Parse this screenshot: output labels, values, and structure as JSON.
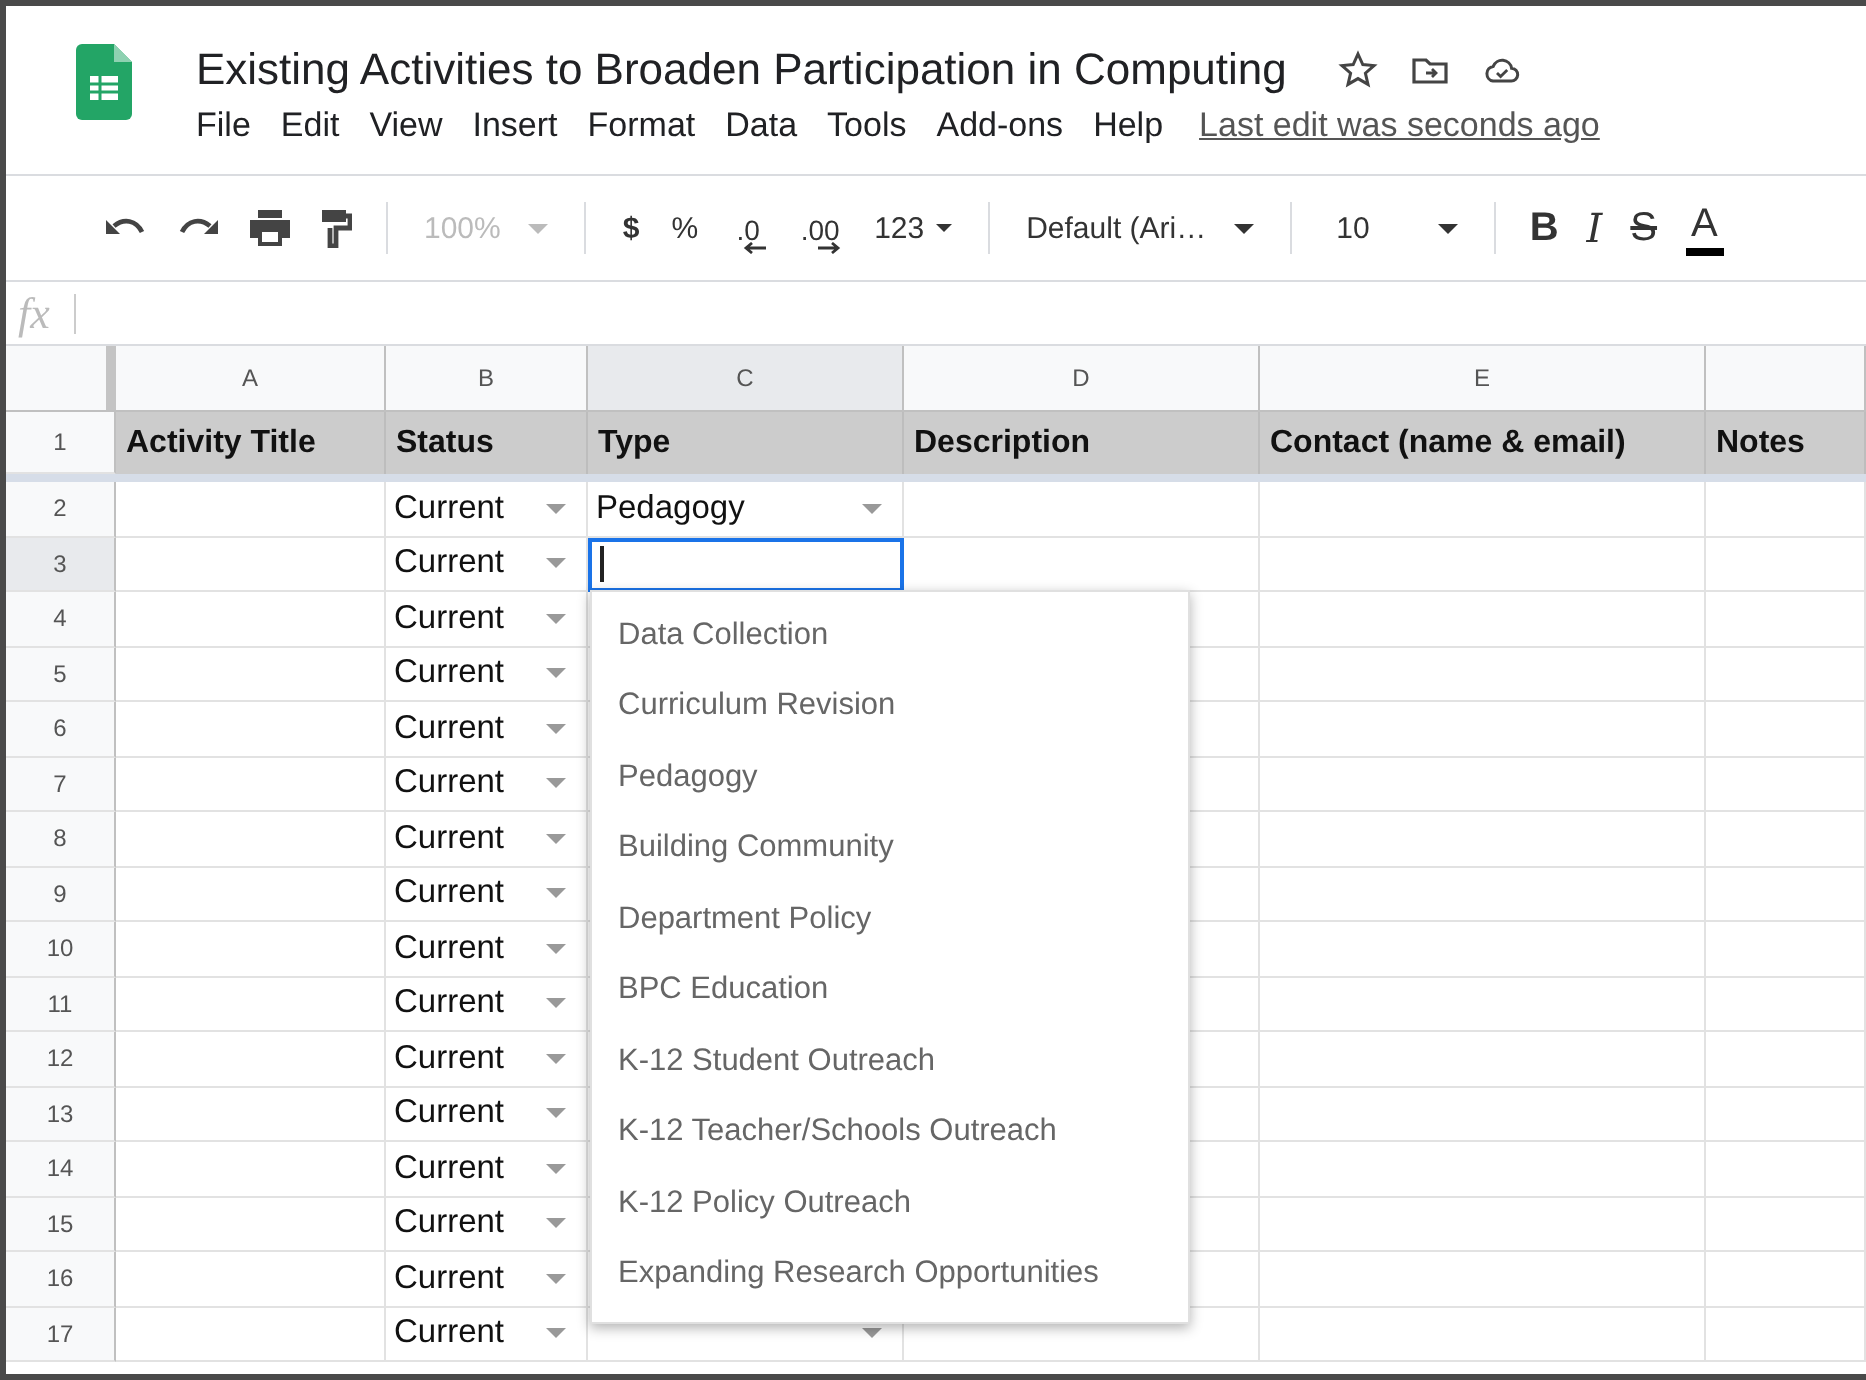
{
  "document": {
    "title": "Existing Activities to Broaden Participation in Computing"
  },
  "menu": [
    "File",
    "Edit",
    "View",
    "Insert",
    "Format",
    "Data",
    "Tools",
    "Add-ons",
    "Help"
  ],
  "last_edit": "Last edit was seconds ago",
  "toolbar": {
    "zoom": {
      "value": "100%",
      "disabled": true
    },
    "currency": "$",
    "percent": "%",
    "decrease_decimals": ".0",
    "increase_decimals": ".00",
    "more_formats": "123",
    "font": "Default (Ari…",
    "font_size": "10",
    "bold": "B",
    "italic": "I",
    "strikethrough": "S",
    "text_color": "A"
  },
  "formula_bar": {
    "fx": "fx"
  },
  "sheet": {
    "columns": [
      "A",
      "B",
      "C",
      "D",
      "E"
    ],
    "header_row": {
      "number": "1",
      "cells": [
        "Activity Title",
        "Status",
        "Type",
        "Description",
        "Contact (name & email)",
        "Notes"
      ]
    },
    "rows": [
      {
        "number": "2",
        "status": "Current",
        "type": "Pedagogy",
        "type_dropdown": true,
        "editing": false
      },
      {
        "number": "3",
        "status": "Current",
        "editing": true
      },
      {
        "number": "4",
        "status": "Current",
        "editing": false
      },
      {
        "number": "5",
        "status": "Current",
        "editing": false
      },
      {
        "number": "6",
        "status": "Current",
        "editing": false
      },
      {
        "number": "7",
        "status": "Current",
        "editing": false
      },
      {
        "number": "8",
        "status": "Current",
        "editing": false
      },
      {
        "number": "9",
        "status": "Current",
        "editing": false
      },
      {
        "number": "10",
        "status": "Current",
        "editing": false
      },
      {
        "number": "11",
        "status": "Current",
        "editing": false
      },
      {
        "number": "12",
        "status": "Current",
        "editing": false
      },
      {
        "number": "13",
        "status": "Current",
        "editing": false
      },
      {
        "number": "14",
        "status": "Current",
        "editing": false
      },
      {
        "number": "15",
        "status": "Current",
        "editing": false
      },
      {
        "number": "16",
        "status": "Current",
        "editing": false
      },
      {
        "number": "17",
        "status": "Current",
        "type_dropdown": true,
        "editing": false
      }
    ]
  },
  "dropdown": {
    "options": [
      "Data Collection",
      "Curriculum Revision",
      "Pedagogy",
      "Building Community",
      "Department Policy",
      "BPC Education",
      "K-12 Student Outreach",
      "K-12 Teacher/Schools Outreach",
      "K-12 Policy Outreach",
      "Expanding Research Opportunities"
    ]
  }
}
